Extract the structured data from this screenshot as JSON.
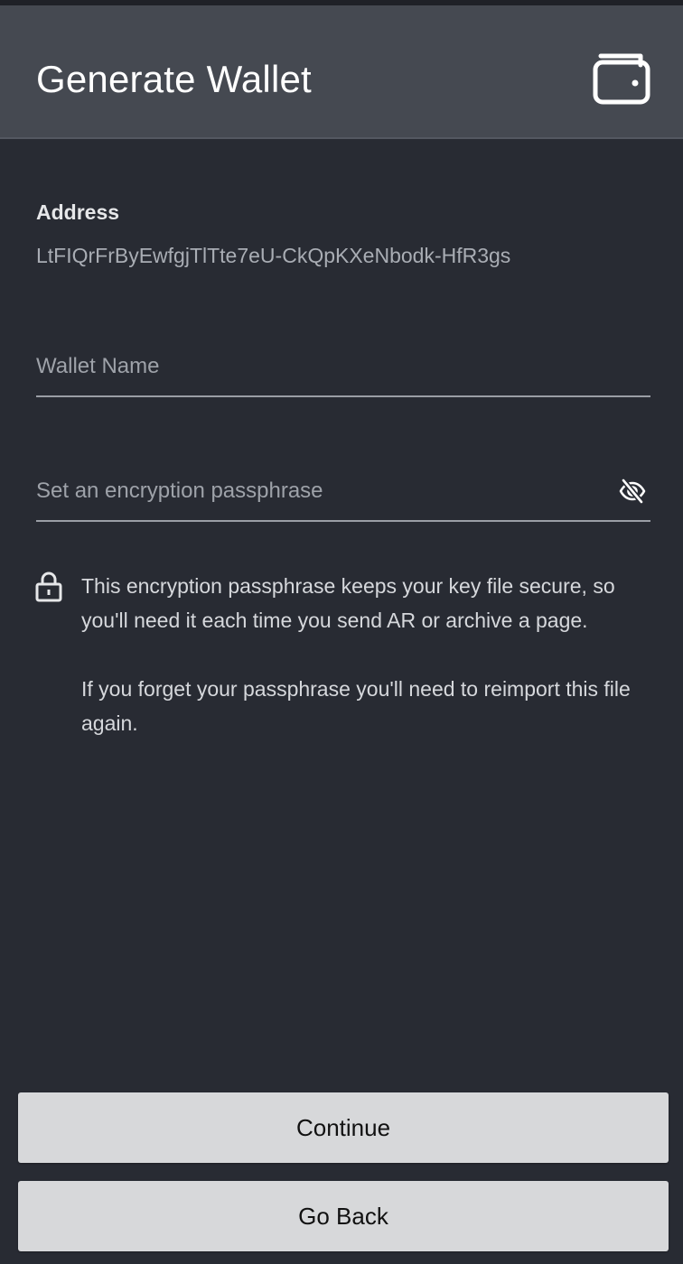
{
  "header": {
    "title": "Generate Wallet",
    "icon": "wallet-icon"
  },
  "address": {
    "label": "Address",
    "value": "LtFIQrFrByEwfgjTlTte7eU-CkQpKXeNbodk-HfR3gs"
  },
  "wallet_name": {
    "placeholder": "Wallet Name",
    "value": ""
  },
  "passphrase": {
    "placeholder": "Set an encryption passphrase",
    "value": "",
    "toggle_icon": "eye-off-icon"
  },
  "info": {
    "icon": "lock-icon",
    "paragraph1": "This encryption passphrase keeps your key file secure, so you'll need it each time you send AR or archive a page.",
    "paragraph2": "If you forget your passphrase you'll need to reimport this file again."
  },
  "buttons": {
    "continue_label": "Continue",
    "back_label": "Go Back"
  },
  "colors": {
    "background": "#282b33",
    "header": "#454951",
    "button": "#d7d8da"
  }
}
